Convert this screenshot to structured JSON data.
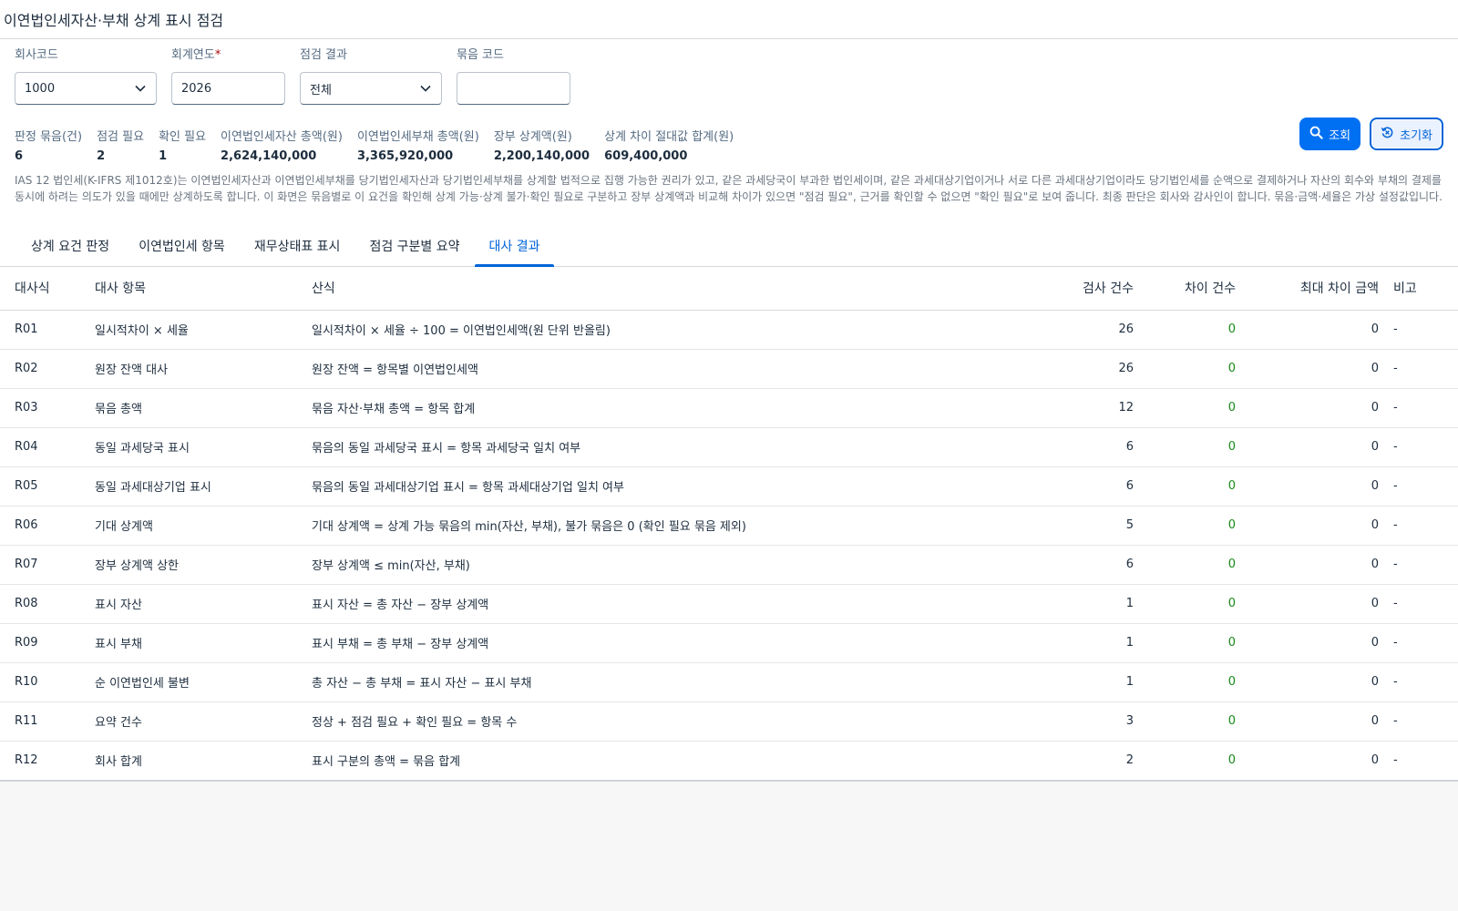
{
  "page": {
    "title": "이연법인세자산·부채 상계 표시 점검"
  },
  "filters": {
    "company": {
      "label": "회사코드",
      "value": "1000"
    },
    "year": {
      "label": "회계연도",
      "required_mark": "*",
      "value": "2026"
    },
    "result": {
      "label": "점검 결과",
      "value": "전체"
    },
    "group": {
      "label": "묶음 코드",
      "value": ""
    }
  },
  "actions": {
    "search_label": "조회",
    "reset_label": "초기화"
  },
  "kpis": [
    {
      "label": "판정 묶음(건)",
      "value": "6"
    },
    {
      "label": "점검 필요",
      "value": "2"
    },
    {
      "label": "확인 필요",
      "value": "1"
    },
    {
      "label": "이연법인세자산 총액(원)",
      "value": "2,624,140,000"
    },
    {
      "label": "이연법인세부채 총액(원)",
      "value": "3,365,920,000"
    },
    {
      "label": "장부 상계액(원)",
      "value": "2,200,140,000"
    },
    {
      "label": "상계 차이 절대값 합계(원)",
      "value": "609,400,000"
    }
  ],
  "description": "IAS 12 법인세(K-IFRS 제1012호)는 이연법인세자산과 이연법인세부채를 당기법인세자산과 당기법인세부채를 상계할 법적으로 집행 가능한 권리가 있고, 같은 과세당국이 부과한 법인세이며, 같은 과세대상기업이거나 서로 다른 과세대상기업이라도 당기법인세를 순액으로 결제하거나 자산의 회수와 부채의 결제를 동시에 하려는 의도가 있을 때에만 상계하도록 합니다. 이 화면은 묶음별로 이 요건을 확인해 상계 가능·상계 불가·확인 필요로 구분하고 장부 상계액과 비교해 차이가 있으면 \"점검 필요\", 근거를 확인할 수 없으면 \"확인 필요\"로 보여 줍니다. 최종 판단은 회사와 감사인이 합니다. 묶음·금액·세율은 가상 설정값입니다.",
  "tabs": [
    {
      "label": "상계 요건 판정",
      "active": false
    },
    {
      "label": "이연법인세 항목",
      "active": false
    },
    {
      "label": "재무상태표 표시",
      "active": false
    },
    {
      "label": "점검 구분별 요약",
      "active": false
    },
    {
      "label": "대사 결과",
      "active": true
    }
  ],
  "table": {
    "headers": {
      "code": "대사식",
      "item": "대사 항목",
      "formula": "산식",
      "checks": "검사 건수",
      "diffs": "차이 건수",
      "max_diff": "최대 차이 금액",
      "note": "비고"
    },
    "rows": [
      {
        "code": "R01",
        "item": "일시적차이 × 세율",
        "formula": "일시적차이 × 세율 ÷ 100 = 이연법인세액(원 단위 반올림)",
        "checks": "26",
        "diffs": "0",
        "max_diff": "0",
        "note": "-"
      },
      {
        "code": "R02",
        "item": "원장 잔액 대사",
        "formula": "원장 잔액 = 항목별 이연법인세액",
        "checks": "26",
        "diffs": "0",
        "max_diff": "0",
        "note": "-"
      },
      {
        "code": "R03",
        "item": "묶음 총액",
        "formula": "묶음 자산·부채 총액 = 항목 합계",
        "checks": "12",
        "diffs": "0",
        "max_diff": "0",
        "note": "-"
      },
      {
        "code": "R04",
        "item": "동일 과세당국 표시",
        "formula": "묶음의 동일 과세당국 표시 = 항목 과세당국 일치 여부",
        "checks": "6",
        "diffs": "0",
        "max_diff": "0",
        "note": "-"
      },
      {
        "code": "R05",
        "item": "동일 과세대상기업 표시",
        "formula": "묶음의 동일 과세대상기업 표시 = 항목 과세대상기업 일치 여부",
        "checks": "6",
        "diffs": "0",
        "max_diff": "0",
        "note": "-"
      },
      {
        "code": "R06",
        "item": "기대 상계액",
        "formula": "기대 상계액 = 상계 가능 묶음의 min(자산, 부채), 불가 묶음은 0 (확인 필요 묶음 제외)",
        "checks": "5",
        "diffs": "0",
        "max_diff": "0",
        "note": "-"
      },
      {
        "code": "R07",
        "item": "장부 상계액 상한",
        "formula": "장부 상계액 ≤ min(자산, 부채)",
        "checks": "6",
        "diffs": "0",
        "max_diff": "0",
        "note": "-"
      },
      {
        "code": "R08",
        "item": "표시 자산",
        "formula": "표시 자산 = 총 자산 − 장부 상계액",
        "checks": "1",
        "diffs": "0",
        "max_diff": "0",
        "note": "-"
      },
      {
        "code": "R09",
        "item": "표시 부채",
        "formula": "표시 부채 = 총 부채 − 장부 상계액",
        "checks": "1",
        "diffs": "0",
        "max_diff": "0",
        "note": "-"
      },
      {
        "code": "R10",
        "item": "순 이연법인세 불변",
        "formula": "총 자산 − 총 부채 = 표시 자산 − 표시 부채",
        "checks": "1",
        "diffs": "0",
        "max_diff": "0",
        "note": "-"
      },
      {
        "code": "R11",
        "item": "요약 건수",
        "formula": "정상 + 점검 필요 + 확인 필요 = 항목 수",
        "checks": "3",
        "diffs": "0",
        "max_diff": "0",
        "note": "-"
      },
      {
        "code": "R12",
        "item": "회사 합계",
        "formula": "표시 구분의 총액 = 묶음 합계",
        "checks": "2",
        "diffs": "0",
        "max_diff": "0",
        "note": "-"
      }
    ]
  },
  "colors": {
    "accent": "#0064d9",
    "primary_button": "#0070f2",
    "zero_diff": "#188918"
  },
  "icons": {
    "dropdown": "chevron-down-icon",
    "search": "search-icon",
    "reset": "reset-icon"
  }
}
